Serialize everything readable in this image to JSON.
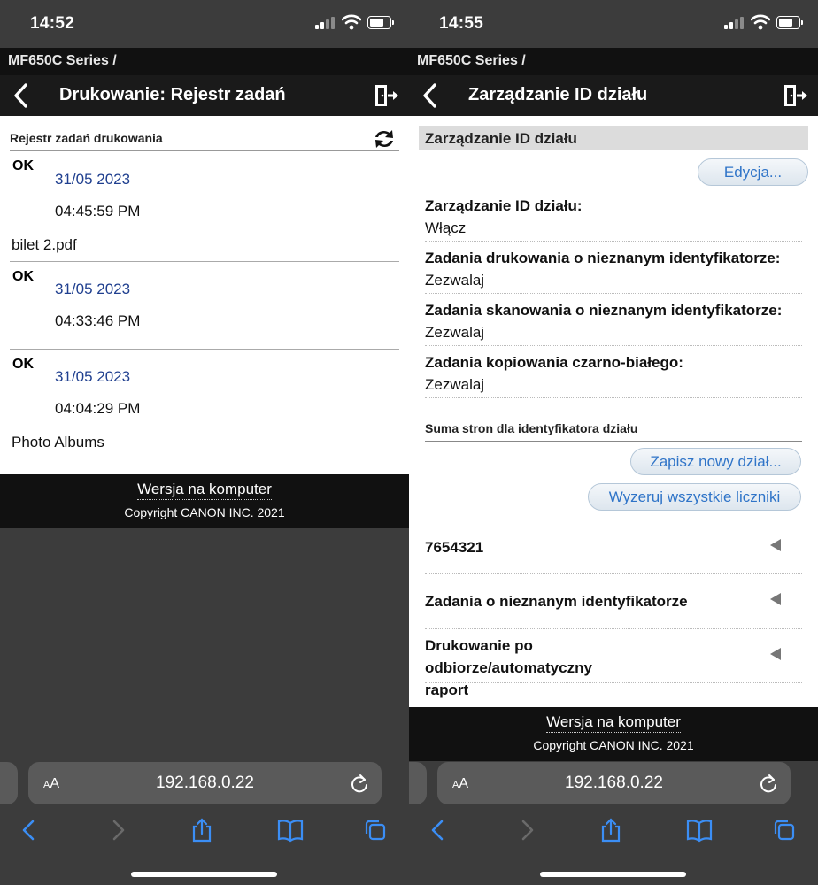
{
  "left": {
    "status": {
      "time": "14:52"
    },
    "series": "MF650C Series /",
    "topbar": {
      "title": "Drukowanie: Rejestr zadań"
    },
    "job_log": {
      "header": "Rejestr zadań drukowania",
      "jobs": [
        {
          "status": "OK",
          "date": "31/05 2023",
          "time": "04:45:59 PM",
          "name": "bilet 2.pdf"
        },
        {
          "status": "OK",
          "date": "31/05 2023",
          "time": "04:33:46 PM",
          "name": ""
        },
        {
          "status": "OK",
          "date": "31/05 2023",
          "time": "04:04:29 PM",
          "name": "Photo Albums"
        }
      ]
    },
    "footer": {
      "desktop_link": "Wersja na komputer",
      "copyright": "Copyright CANON INC. 2021"
    },
    "browser": {
      "text_size": "AA",
      "url": "192.168.0.22"
    }
  },
  "right": {
    "status": {
      "time": "14:55"
    },
    "series": "MF650C Series /",
    "topbar": {
      "title": "Zarządzanie ID działu"
    },
    "section": {
      "header": "Zarządzanie ID działu",
      "edit_button": "Edycja...",
      "settings": [
        {
          "key": "Zarządzanie ID działu:",
          "value": "Włącz"
        },
        {
          "key": "Zadania drukowania o nieznanym identyfikatorze:",
          "value": "Zezwalaj"
        },
        {
          "key": "Zadania skanowania o nieznanym identyfikatorze:",
          "value": "Zezwalaj"
        },
        {
          "key": "Zadania kopiowania czarno-białego:",
          "value": "Zezwalaj"
        }
      ]
    },
    "page_totals": {
      "header": "Suma stron dla identyfikatora działu",
      "register_button": "Zapisz nowy dział...",
      "reset_button": "Wyzeruj wszystkie liczniki",
      "departments": [
        {
          "name": "7654321"
        },
        {
          "name": "Zadania o nieznanym identyfikatorze"
        },
        {
          "name": "Drukowanie po odbiorze/automatyczny raport"
        }
      ]
    },
    "footer": {
      "desktop_link": "Wersja na komputer",
      "copyright": "Copyright CANON INC. 2021"
    },
    "browser": {
      "text_size": "AA",
      "url": "192.168.0.22"
    }
  },
  "colors": {
    "link_blue": "#2f74c8",
    "date_blue": "#1f3f8f",
    "header_dark": "#1a1a1a",
    "safari_blue": "#3b8ef5"
  },
  "icons": [
    "back-chevron-icon",
    "logout-icon",
    "refresh-icon",
    "reload-icon",
    "share-icon",
    "bookmarks-icon",
    "tabs-icon",
    "forward-icon",
    "signal-icon",
    "wifi-icon",
    "battery-icon",
    "dropdown-arrow-icon"
  ]
}
